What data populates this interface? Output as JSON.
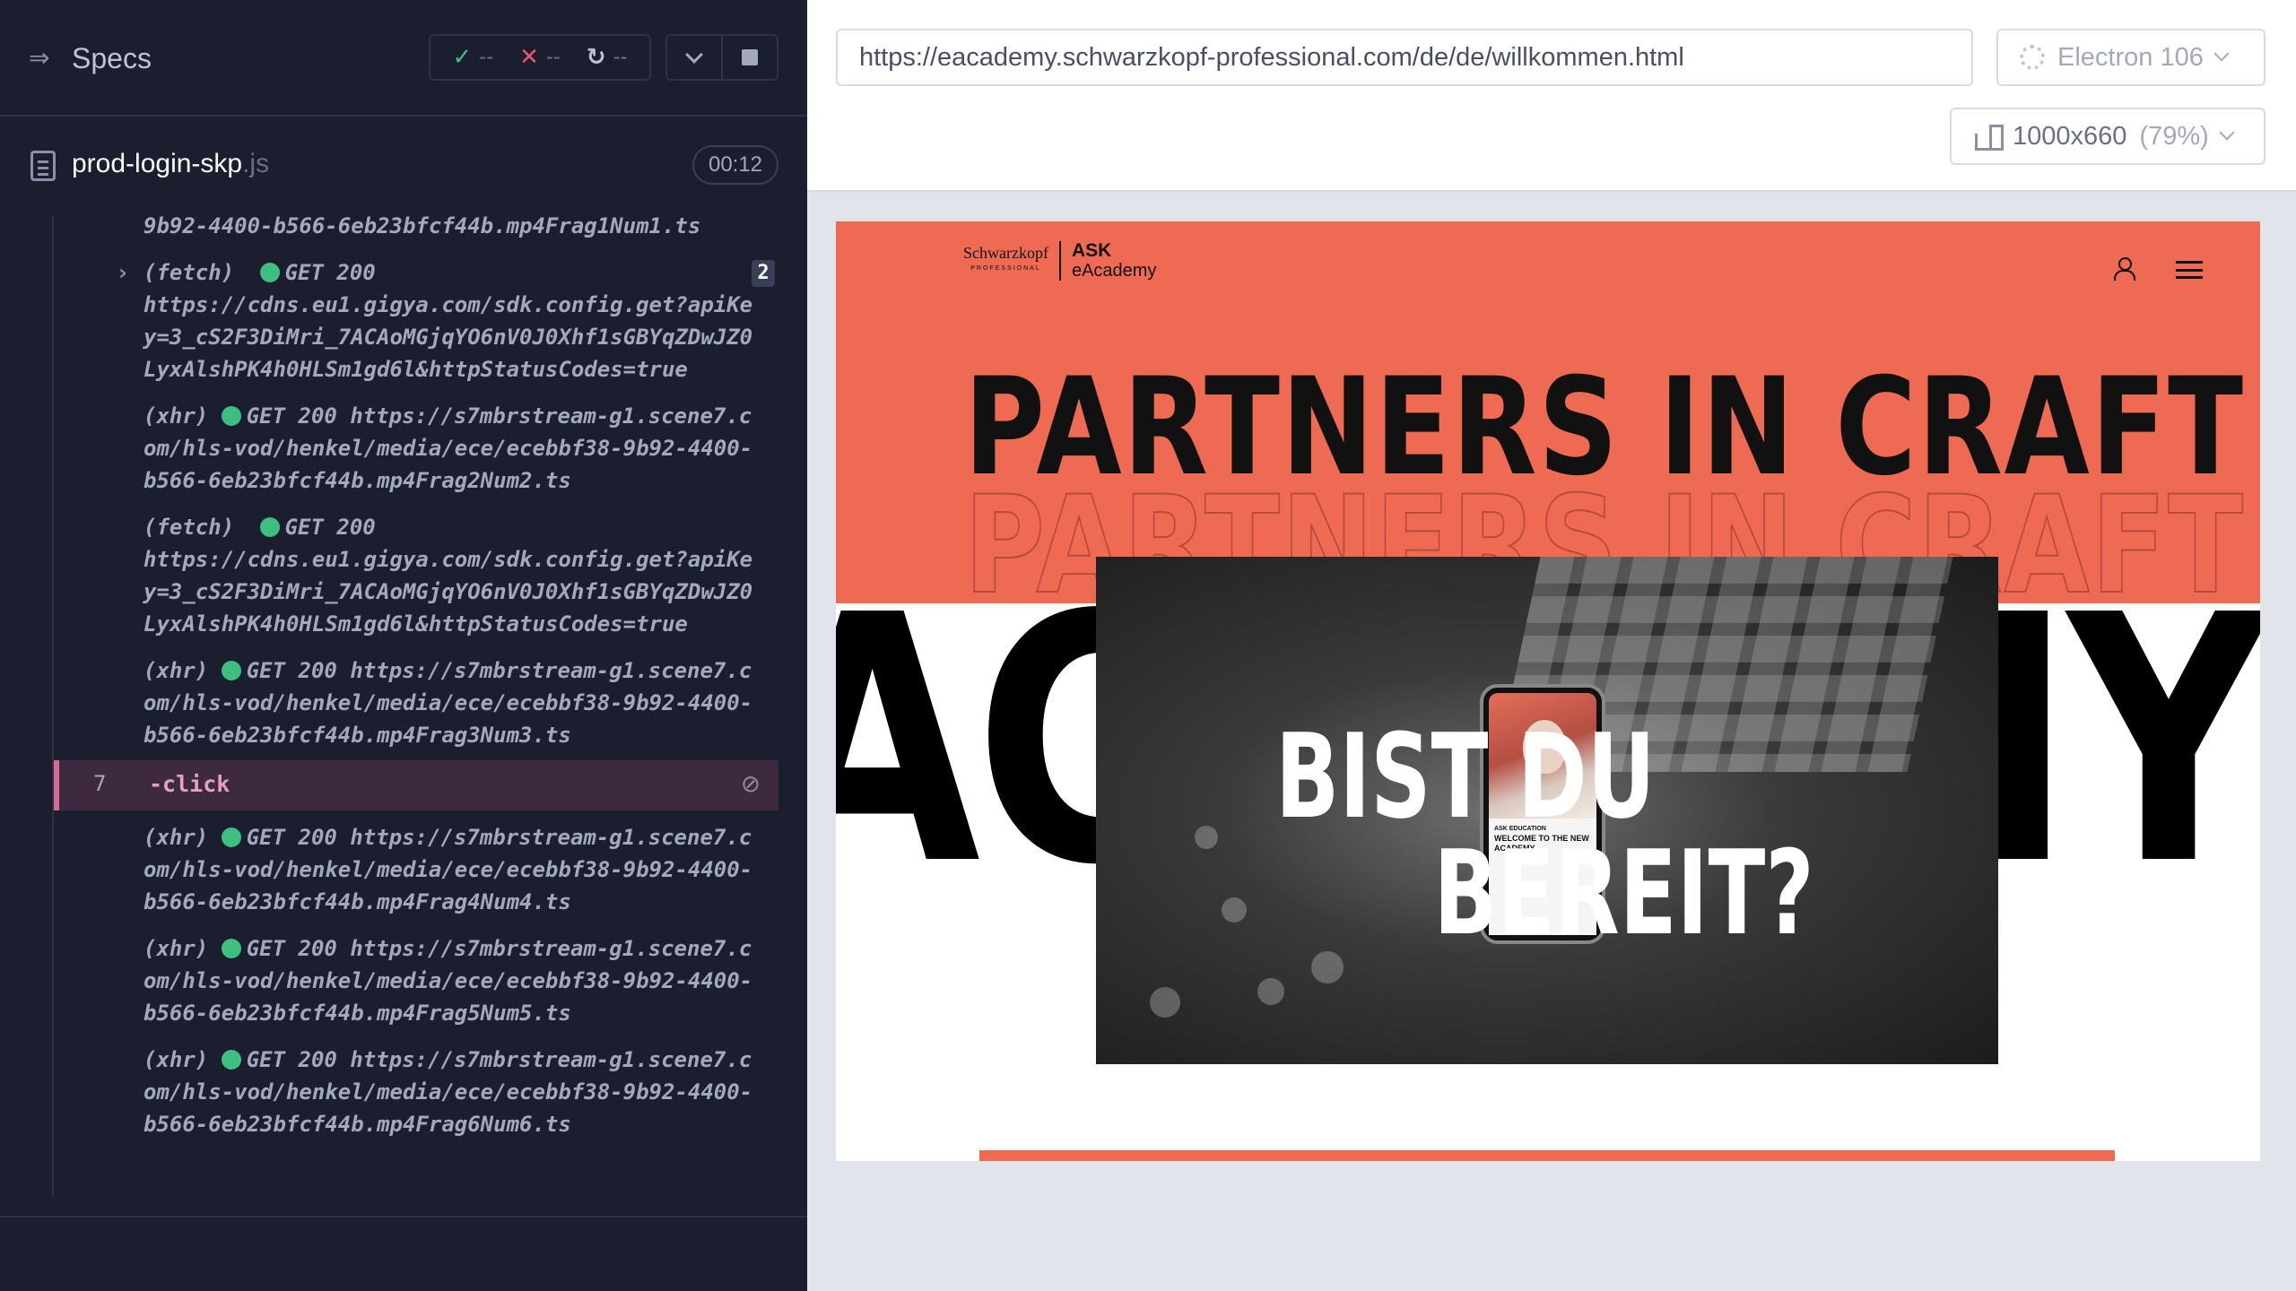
{
  "reporter": {
    "specs_label": "Specs",
    "stats": {
      "passed": "--",
      "failed": "--",
      "pending": "--"
    },
    "file": {
      "name": "prod-login-skp",
      "ext": ".js",
      "duration": "00:12"
    },
    "commands": [
      {
        "kind": "partial",
        "text": "9b92-4400-b566-6eb23bfcf44b.mp4Frag1Num1.ts"
      },
      {
        "kind": "fetch",
        "expandable": true,
        "count": "2",
        "method": "(fetch)",
        "status": "GET 200",
        "url": "https://cdns.eu1.gigya.com/sdk.config.get?apiKey=3_cS2F3DiMri_7ACAoMGjqYO6nV0J0Xhf1sGBYqZDwJZ0LyxAlshPK4h0HLSm1gd6l&httpStatusCodes=true"
      },
      {
        "kind": "xhr",
        "method": "(xhr)",
        "status": "GET 200",
        "url": "https://s7mbrstream-g1.scene7.com/hls-vod/henkel/media/ece/ecebbf38-9b92-4400-b566-6eb23bfcf44b.mp4Frag2Num2.ts"
      },
      {
        "kind": "fetch",
        "method": "(fetch)",
        "status": "GET 200",
        "url": "https://cdns.eu1.gigya.com/sdk.config.get?apiKey=3_cS2F3DiMri_7ACAoMGjqYO6nV0J0Xhf1sGBYqZDwJZ0LyxAlshPK4h0HLSm1gd6l&httpStatusCodes=true"
      },
      {
        "kind": "xhr",
        "method": "(xhr)",
        "status": "GET 200",
        "url": "https://s7mbrstream-g1.scene7.com/hls-vod/henkel/media/ece/ecebbf38-9b92-4400-b566-6eb23bfcf44b.mp4Frag3Num3.ts"
      }
    ],
    "click_command": {
      "number": "7",
      "name": "-click"
    },
    "commands_after": [
      {
        "method": "(xhr)",
        "status": "GET 200",
        "url": "https://s7mbrstream-g1.scene7.com/hls-vod/henkel/media/ece/ecebbf38-9b92-4400-b566-6eb23bfcf44b.mp4Frag4Num4.ts"
      },
      {
        "method": "(xhr)",
        "status": "GET 200",
        "url": "https://s7mbrstream-g1.scene7.com/hls-vod/henkel/media/ece/ecebbf38-9b92-4400-b566-6eb23bfcf44b.mp4Frag5Num5.ts"
      },
      {
        "method": "(xhr)",
        "status": "GET 200",
        "url": "https://s7mbrstream-g1.scene7.com/hls-vod/henkel/media/ece/ecebbf38-9b92-4400-b566-6eb23bfcf44b.mp4Frag6Num6.ts"
      }
    ]
  },
  "aut": {
    "url": "https://eacademy.schwarzkopf-professional.com/de/de/willkommen.html",
    "browser": "Electron 106",
    "viewport": "1000x660",
    "scale": "(79%)"
  },
  "site": {
    "logo_brand": "Schwarzkopf",
    "logo_brand_sub": "PROFESSIONAL",
    "logo_ask": "ASK",
    "logo_eacademy": "eAcademy",
    "headline": "PARTNERS IN CRAFT",
    "background_word": "ACADEMY",
    "video_line1": "BIST DU",
    "video_line2": "BEREIT?",
    "phone_caption_small": "ASK EDUCATION",
    "phone_caption": "WELCOME TO THE NEW ACADEMY"
  },
  "icons": {
    "specs": "specs-toggle-icon",
    "passed": "check-icon",
    "failed": "x-icon",
    "pending": "spinner-icon",
    "file": "document-icon",
    "hidden": "eye-slash-icon",
    "browser": "electron-icon",
    "viewport": "ruler-icon",
    "user": "user-icon",
    "menu": "hamburger-menu-icon"
  },
  "colors": {
    "reporter_bg": "#1b1e2e",
    "passed": "#3fbf7f",
    "failed": "#e45770",
    "click_highlight": "#d86b95",
    "brand_coral": "#ee6a53"
  }
}
